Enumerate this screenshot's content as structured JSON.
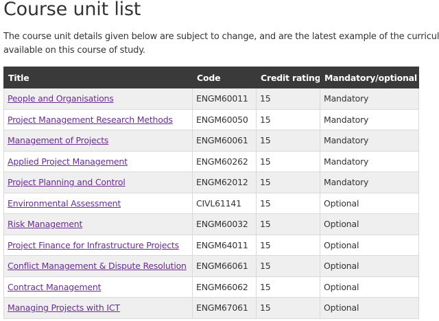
{
  "page": {
    "title": "Course unit list",
    "intro_line1": "The course unit details given below are subject to change, and are the latest example of the curriculum",
    "intro_line2": "available on this course of study."
  },
  "table": {
    "headers": [
      "Title",
      "Code",
      "Credit rating",
      "Mandatory/optional"
    ],
    "rows": [
      {
        "title": "People and Organisations",
        "code": "ENGM60011",
        "credit": "15",
        "status": "Mandatory"
      },
      {
        "title": "Project Management Research Methods",
        "code": "ENGM60050",
        "credit": "15",
        "status": "Mandatory"
      },
      {
        "title": "Management of Projects",
        "code": "ENGM60061",
        "credit": "15",
        "status": "Mandatory"
      },
      {
        "title": "Applied Project Management",
        "code": "ENGM60262",
        "credit": "15",
        "status": "Mandatory"
      },
      {
        "title": "Project Planning and Control",
        "code": "ENGM62012",
        "credit": "15",
        "status": "Mandatory"
      },
      {
        "title": "Environmental Assessment",
        "code": "CIVL61141",
        "credit": "15",
        "status": "Optional"
      },
      {
        "title": "Risk Management",
        "code": "ENGM60032",
        "credit": "15",
        "status": "Optional"
      },
      {
        "title": "Project Finance for Infrastructure Projects",
        "code": "ENGM64011",
        "credit": "15",
        "status": "Optional"
      },
      {
        "title": "Conflict Management & Dispute Resolution",
        "code": "ENGM66061",
        "credit": "15",
        "status": "Optional"
      },
      {
        "title": "Contract Management",
        "code": "ENGM66062",
        "credit": "15",
        "status": "Optional"
      },
      {
        "title": "Managing Projects with ICT",
        "code": "ENGM67061",
        "credit": "15",
        "status": "Optional"
      }
    ]
  },
  "colors": {
    "header_bg": "#3a3a3a",
    "link": "#6a2c91",
    "row_alt": "#efefef"
  }
}
